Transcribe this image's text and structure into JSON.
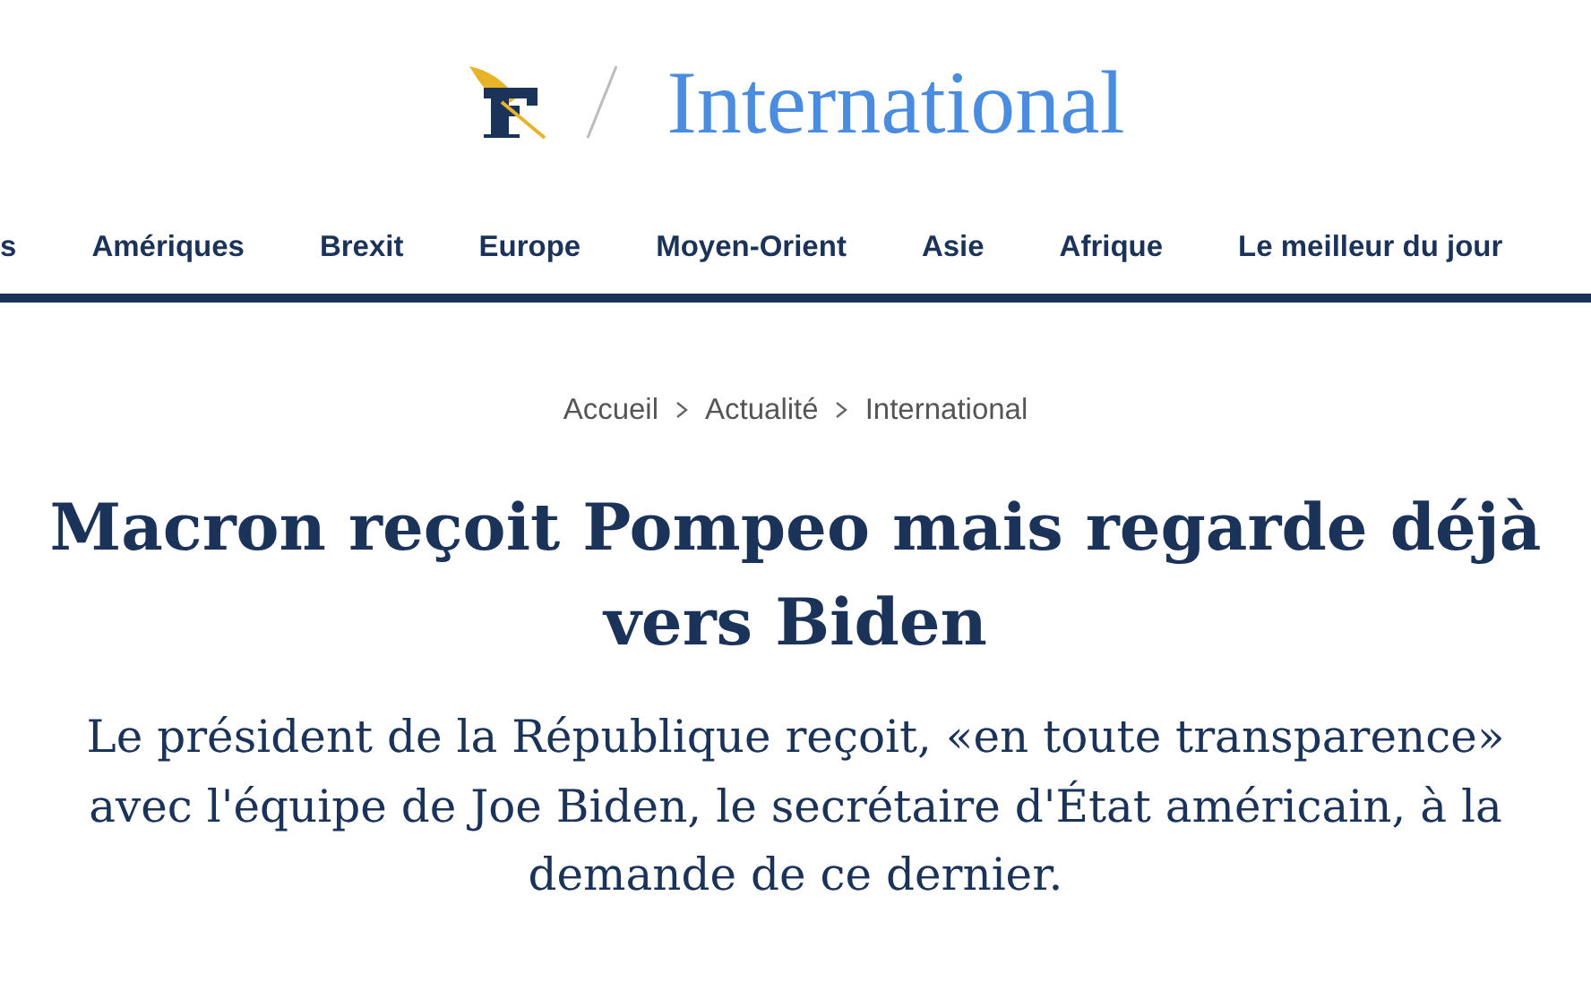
{
  "header": {
    "section_title": "International"
  },
  "nav": {
    "items": [
      {
        "label": "s"
      },
      {
        "label": "Amériques"
      },
      {
        "label": "Brexit"
      },
      {
        "label": "Europe"
      },
      {
        "label": "Moyen-Orient"
      },
      {
        "label": "Asie"
      },
      {
        "label": "Afrique"
      },
      {
        "label": "Le meilleur du jour"
      }
    ]
  },
  "breadcrumb": [
    "Accueil",
    "Actualité",
    "International"
  ],
  "article": {
    "headline": "Macron reçoit Pompeo mais regarde déjà vers Biden",
    "standfirst": "Le président de la République reçoit, «en toute transparence» avec l'équipe de Joe Biden, le secrétaire d'État américain, à la demande de ce dernier."
  }
}
